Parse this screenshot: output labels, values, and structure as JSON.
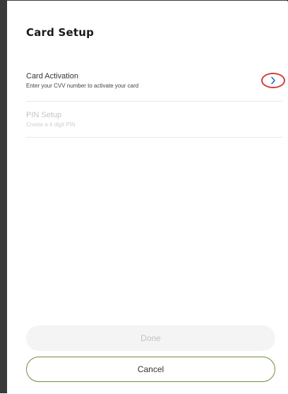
{
  "header": {
    "title": "Card Setup"
  },
  "setup_items": [
    {
      "title": "Card Activation",
      "subtitle": "Enter your CVV number to activate your card",
      "icon": "chevron-right-icon",
      "enabled": true
    },
    {
      "title": "PIN Setup",
      "subtitle": "Create a 4 digit PIN",
      "enabled": false
    }
  ],
  "footer": {
    "done_label": "Done",
    "cancel_label": "Cancel"
  },
  "colors": {
    "highlight_ring": "#d63a3a",
    "chevron": "#2b5fa8",
    "cancel_border": "#6f8f3a",
    "disabled_text": "#c2c2c2"
  }
}
